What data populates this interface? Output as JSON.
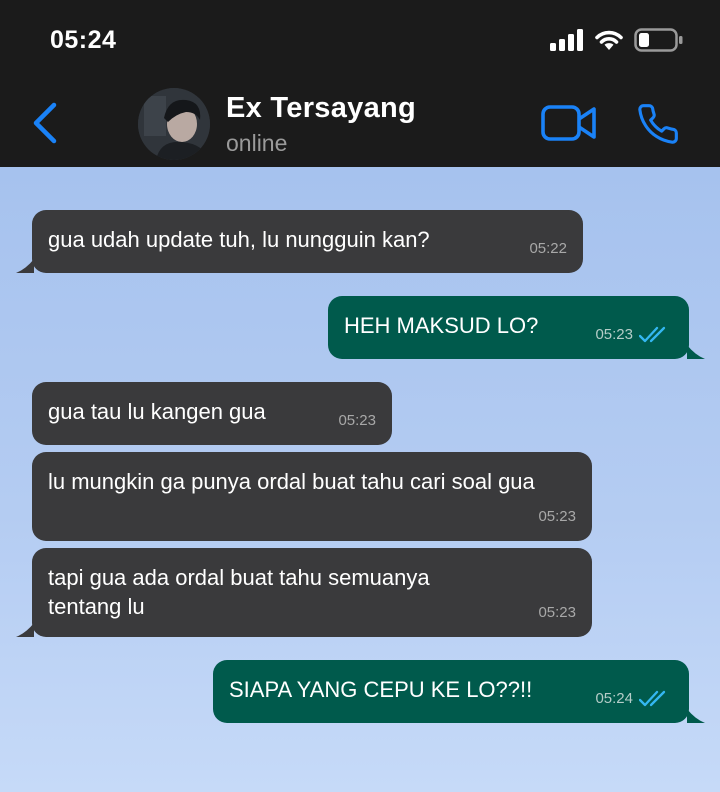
{
  "status_bar": {
    "time": "05:24"
  },
  "header": {
    "contact_name": "Ex Tersayang",
    "contact_status": "online",
    "icons": {
      "back": "chevron-left-icon",
      "video": "video-camera-icon",
      "call": "phone-icon"
    },
    "accent_color": "#1a82f7"
  },
  "messages": [
    {
      "direction": "incoming",
      "text": "gua udah update tuh, lu nungguin kan?",
      "time": "05:22"
    },
    {
      "direction": "outgoing",
      "text": "HEH MAKSUD LO?",
      "time": "05:23",
      "status": "read"
    },
    {
      "direction": "incoming",
      "text": "gua tau lu kangen gua",
      "time": "05:23"
    },
    {
      "direction": "incoming",
      "text": "lu mungkin ga punya ordal buat tahu cari soal gua",
      "time": "05:23"
    },
    {
      "direction": "incoming",
      "text": "tapi gua ada ordal buat tahu semuanya tentang lu",
      "time": "05:23"
    },
    {
      "direction": "outgoing",
      "text": "SIAPA YANG CEPU KE LO??!!",
      "time": "05:24",
      "status": "read"
    }
  ],
  "colors": {
    "incoming_bubble": "#3a3a3c",
    "outgoing_bubble": "#005a4c",
    "read_ticks": "#34b7f1"
  }
}
